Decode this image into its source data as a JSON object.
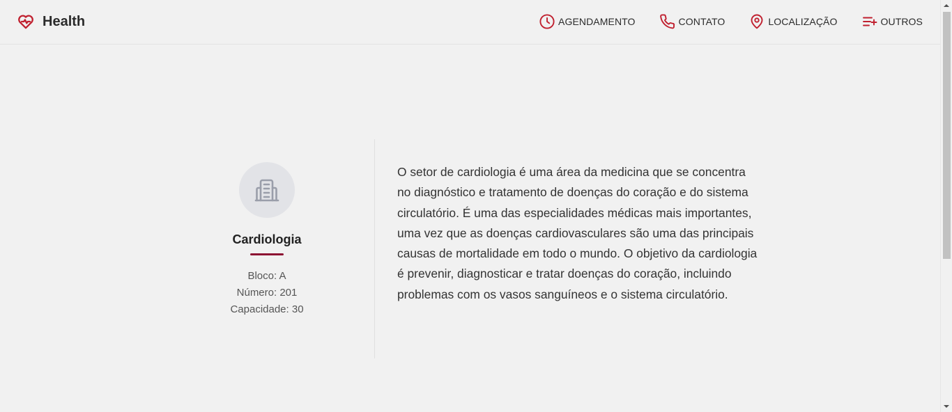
{
  "brand": {
    "name": "Health",
    "icon": "heart-pulse-icon"
  },
  "nav": {
    "items": [
      {
        "label": "AGENDAMENTO",
        "icon": "clock-icon"
      },
      {
        "label": "CONTATO",
        "icon": "phone-icon"
      },
      {
        "label": "LOCALIZAÇÃO",
        "icon": "map-pin-icon"
      },
      {
        "label": "OUTROS",
        "icon": "list-plus-icon"
      }
    ]
  },
  "room": {
    "icon": "building-icon",
    "name": "Cardiologia",
    "block": "Bloco: A",
    "number": "Número: 201",
    "capacity": "Capacidade: 30",
    "description": "O setor de cardiologia é uma área da medicina que se concentra no diagnóstico e tratamento de doenças do coração e do sistema circulatório. É uma das especialidades médicas mais importantes, uma vez que as doenças cardiovasculares são uma das principais causas de mortalidade em todo o mundo. O objetivo da cardiologia é prevenir, diagnosticar e tratar doenças do coração, incluindo problemas com os vasos sanguíneos e o sistema circulatório."
  },
  "colors": {
    "accent": "#c0202f",
    "underline": "#8c1232",
    "background": "#f1f1f1"
  }
}
